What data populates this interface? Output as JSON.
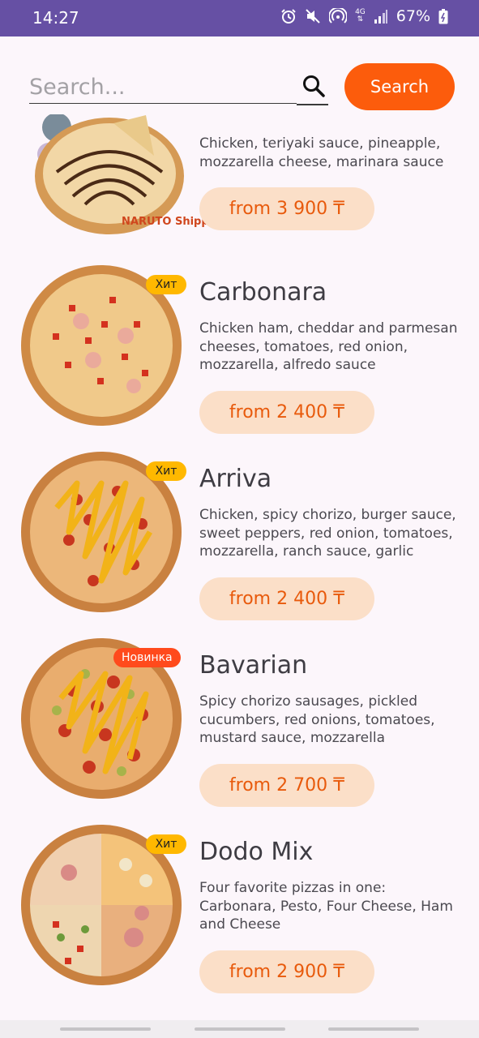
{
  "status_bar": {
    "time": "14:27",
    "network": "4G",
    "battery": "67%",
    "icons": [
      "alarm-icon",
      "mute-icon",
      "hotspot-icon",
      "network-4g-icon",
      "signal-icon",
      "battery-icon"
    ]
  },
  "search": {
    "placeholder": "Search...",
    "value": "",
    "button_label": "Search"
  },
  "colors": {
    "status_bar": "#6650a4",
    "accent": "#fc5c0c",
    "price_bg": "#fbdfc8",
    "price_text": "#e85a0c",
    "badge_hit": "#ffb800",
    "badge_new": "#ff4a1c"
  },
  "menu": {
    "items": [
      {
        "name": "",
        "description": "Chicken, teriyaki sauce, pineapple, mozzarella cheese, marinara sauce",
        "price": "from 3 900 ₸",
        "badge": "",
        "logo": "NARUTO Shippuden"
      },
      {
        "name": "Carbonara",
        "description": "Chicken ham, cheddar and parmesan cheeses, tomatoes, red onion, mozzarella, alfredo sauce",
        "price": "from 2 400 ₸",
        "badge": "Хит"
      },
      {
        "name": "Arriva",
        "description": "Chicken, spicy chorizo, burger sauce, sweet peppers, red onion, tomatoes, mozzarella, ranch sauce, garlic",
        "price": "from 2 400 ₸",
        "badge": "Хит"
      },
      {
        "name": "Bavarian",
        "description": "Spicy chorizo sausages, pickled cucumbers, red onions, tomatoes, mustard sauce, mozzarella",
        "price": "from 2 700 ₸",
        "badge": "Новинка"
      },
      {
        "name": "Dodo Mix",
        "description": "Four favorite pizzas in one: Carbonara, Pesto, Four Cheese, Ham and Cheese",
        "price": "from 2 900 ₸",
        "badge": "Хит"
      }
    ]
  }
}
